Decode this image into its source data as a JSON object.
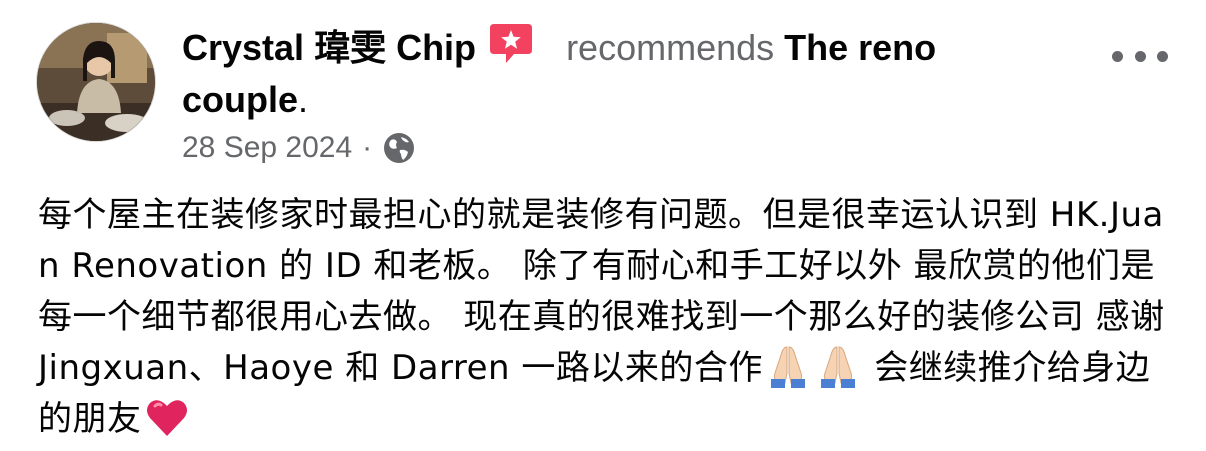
{
  "post": {
    "author_name": "Crystal 瑋雯 Chip",
    "recommends_badge_icon": "recommend-star-icon",
    "verb": " recommends ",
    "page_name": "The reno couple",
    "period": ".",
    "date": "28 Sep 2024",
    "separator": "·",
    "privacy_icon": "globe-icon",
    "more_icon": "more-horizontal-icon",
    "body_text": "每个屋主在装修家时最担心的就是装修有问题。但是很幸运认识到 HK.Juan Renovation 的 ID 和老板。 除了有耐心和手工好以外 最欣赏的他们是每一个细节都很用心去做。 现在真的很难找到一个那么好的装修公司 感谢 Jingxuan、Haoye 和 Darren 一路以来的合作",
    "emojis": [
      "folded-hands-emoji",
      "folded-hands-emoji"
    ],
    "body_text_end": " 会继续推介给身边的朋友",
    "end_emoji": "red-heart-emoji"
  },
  "colors": {
    "primary_text": "#050505",
    "secondary_text": "#65676b",
    "badge_pink": "#f3425f",
    "heart_red": "#e0245e"
  }
}
